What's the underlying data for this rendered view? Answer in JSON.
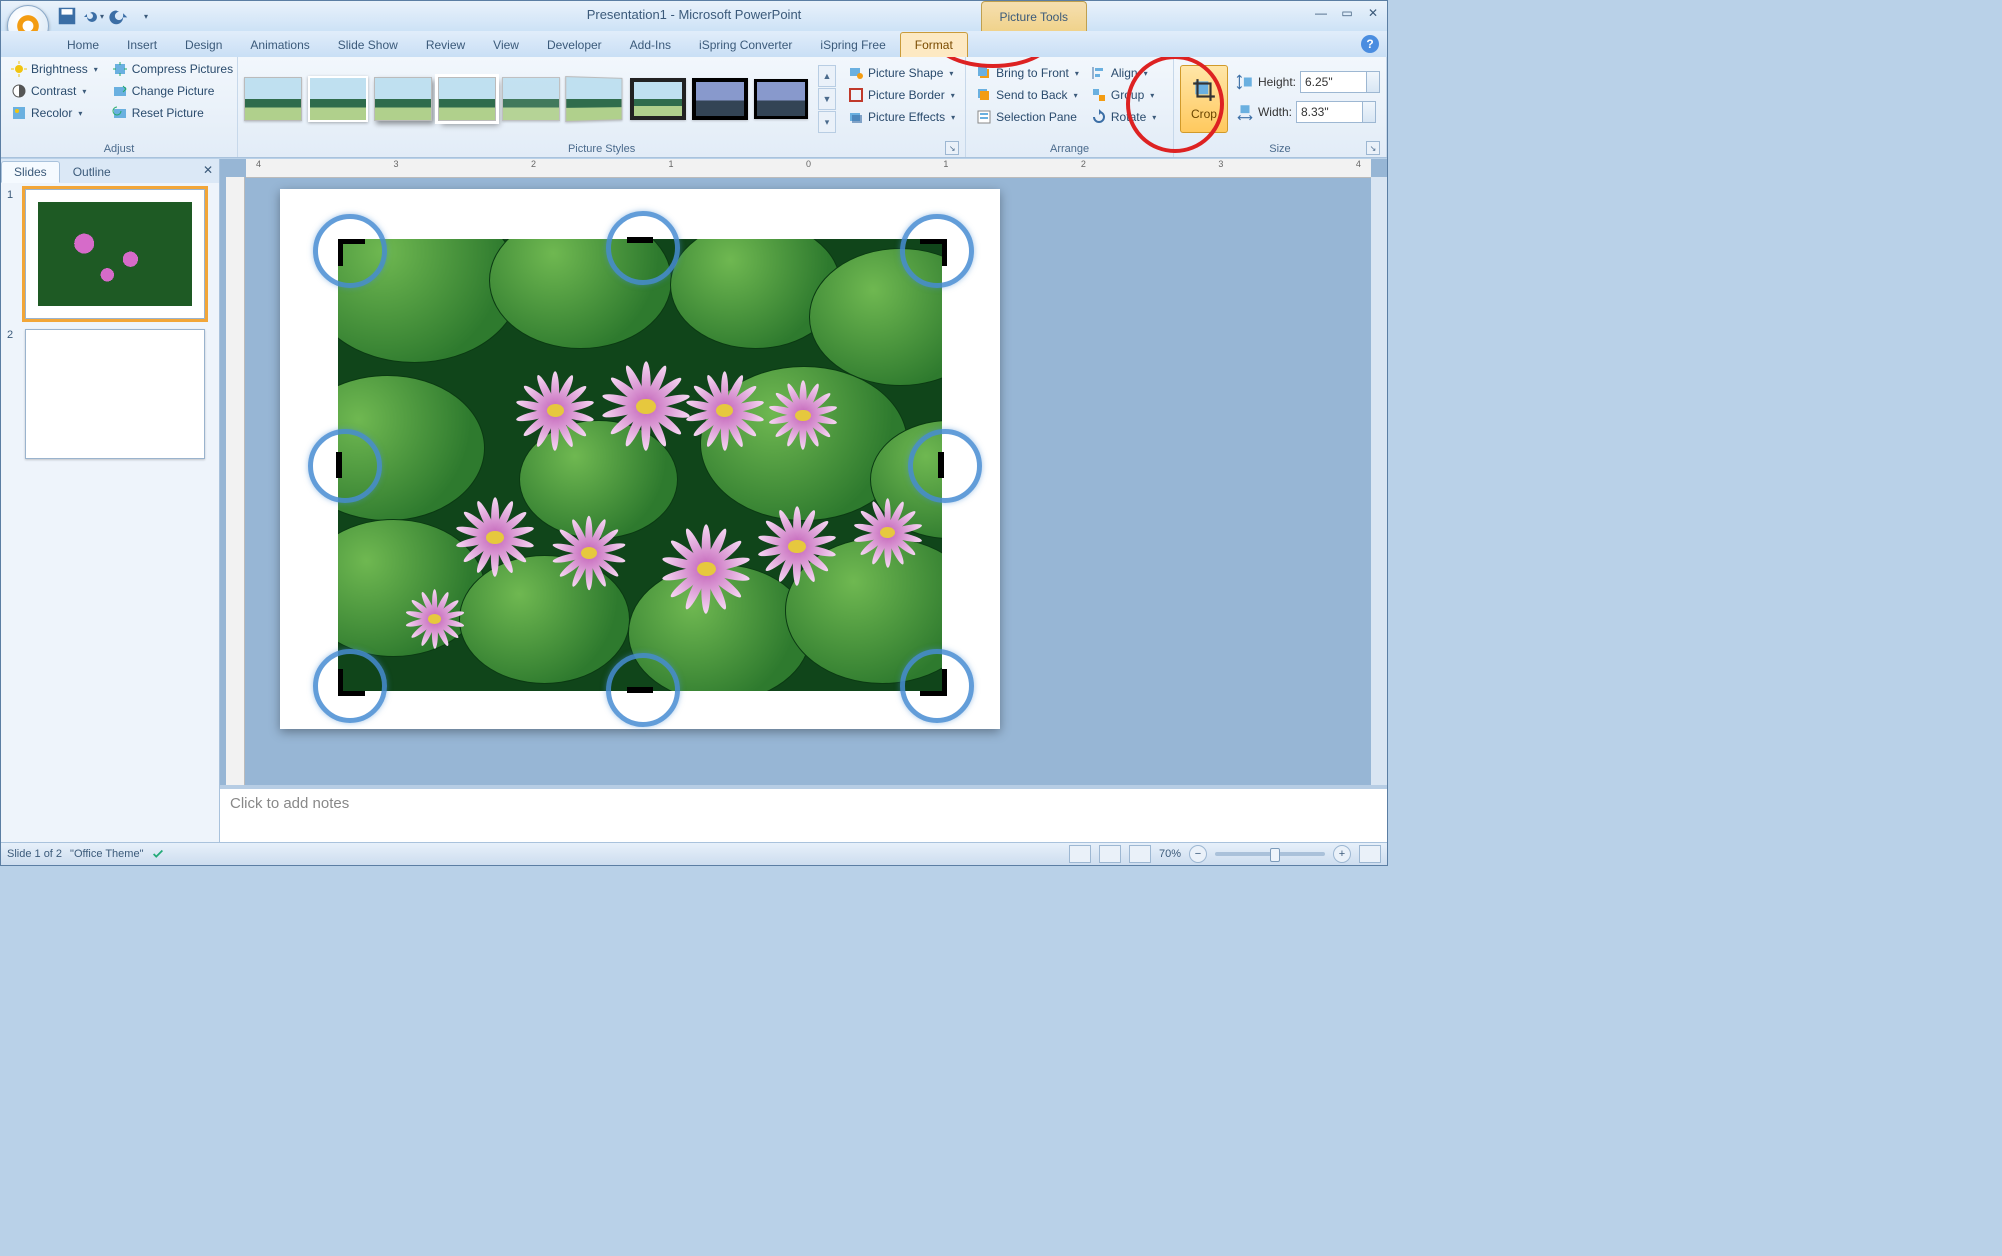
{
  "title": "Presentation1 - Microsoft PowerPoint",
  "context_tab": "Picture Tools",
  "tabs": [
    "Home",
    "Insert",
    "Design",
    "Animations",
    "Slide Show",
    "Review",
    "View",
    "Developer",
    "Add-Ins",
    "iSpring Converter",
    "iSpring Free",
    "Format"
  ],
  "active_tab": "Format",
  "ribbon": {
    "adjust": {
      "brightness": "Brightness",
      "contrast": "Contrast",
      "recolor": "Recolor",
      "compress": "Compress Pictures",
      "change": "Change Picture",
      "reset": "Reset Picture",
      "label": "Adjust"
    },
    "styles": {
      "shape": "Picture Shape",
      "border": "Picture Border",
      "effects": "Picture Effects",
      "label": "Picture Styles"
    },
    "arrange": {
      "front": "Bring to Front",
      "back": "Send to Back",
      "selpane": "Selection Pane",
      "align": "Align",
      "group": "Group",
      "rotate": "Rotate",
      "label": "Arrange"
    },
    "size": {
      "crop": "Crop",
      "height_label": "Height:",
      "width_label": "Width:",
      "height_value": "6.25\"",
      "width_value": "8.33\"",
      "label": "Size"
    }
  },
  "slide_panel": {
    "tabs": [
      "Slides",
      "Outline"
    ],
    "active": "Slides",
    "slides": [
      1,
      2
    ]
  },
  "ruler_marks": [
    "4",
    "3",
    "2",
    "1",
    "0",
    "1",
    "2",
    "3",
    "4"
  ],
  "notes_placeholder": "Click to add notes",
  "status": {
    "slide": "Slide 1 of 2",
    "theme": "\"Office Theme\"",
    "zoom": "70%"
  }
}
